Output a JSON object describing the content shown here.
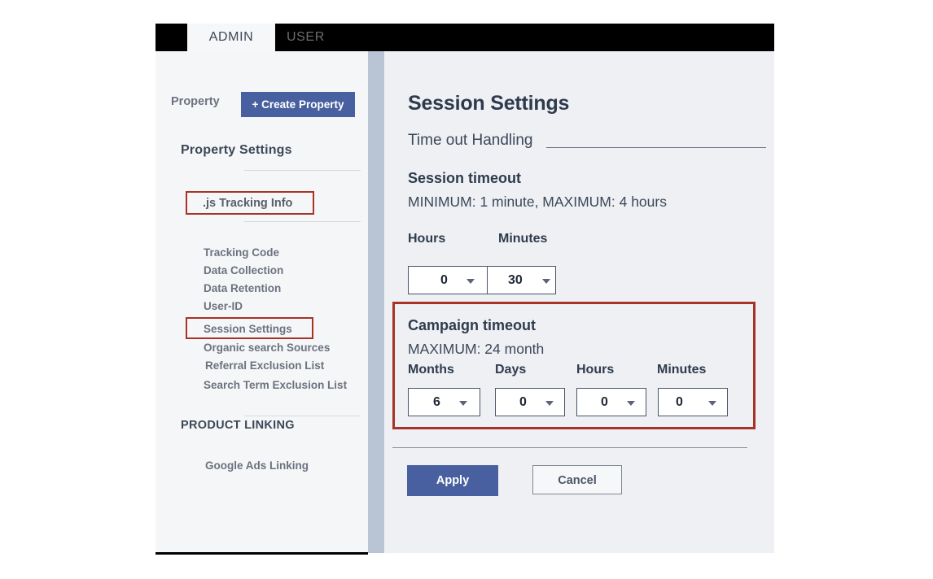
{
  "tabs": [
    {
      "label": "ADMIN",
      "active": true
    },
    {
      "label": "USER",
      "active": false
    }
  ],
  "sidebar": {
    "property_label": "Property",
    "create_property_button": "+ Create Property",
    "section_title": "Property  Settings",
    "tracking_info": {
      "prefix": ".js",
      "label": ".js  Tracking Info",
      "highlighted": true
    },
    "items": [
      {
        "label": "Tracking Code",
        "highlighted": false
      },
      {
        "label": "Data Collection",
        "highlighted": false
      },
      {
        "label": "Data Retention",
        "highlighted": false
      },
      {
        "label": "User-ID",
        "highlighted": false
      },
      {
        "label": "Session Settings",
        "highlighted": true
      },
      {
        "label": "Organic search Sources",
        "highlighted": false
      },
      {
        "label": "Referral Exclusion List",
        "highlighted": false
      },
      {
        "label": "Search Term Exclusion List",
        "highlighted": false
      }
    ],
    "product_linking_title": "PRODUCT LINKING",
    "product_linking_items": [
      {
        "label": "Google Ads Linking"
      }
    ]
  },
  "main": {
    "title": "Session Settings",
    "subsection": "Time out Handling",
    "session_timeout": {
      "title": "Session timeout",
      "constraint": "MINIMUM: 1 minute, MAXIMUM: 4 hours",
      "fields": [
        {
          "label": "Hours",
          "value": "0"
        },
        {
          "label": "Minutes",
          "value": "30"
        }
      ]
    },
    "campaign_timeout": {
      "title": "Campaign timeout",
      "constraint": "MAXIMUM: 24 month",
      "highlighted": true,
      "fields": [
        {
          "label": "Months",
          "value": "6"
        },
        {
          "label": "Days",
          "value": "0"
        },
        {
          "label": "Hours",
          "value": "0"
        },
        {
          "label": "Minutes",
          "value": "0"
        }
      ]
    },
    "actions": {
      "apply": "Apply",
      "cancel": "Cancel"
    }
  },
  "colors": {
    "accent_blue": "#48609f",
    "highlight_red": "#a93226",
    "sidebar_bg": "#f5f6f7",
    "panel_bg": "#eef0f4",
    "divider_bar": "#b9c4d4",
    "topbar_bg": "#000000"
  }
}
